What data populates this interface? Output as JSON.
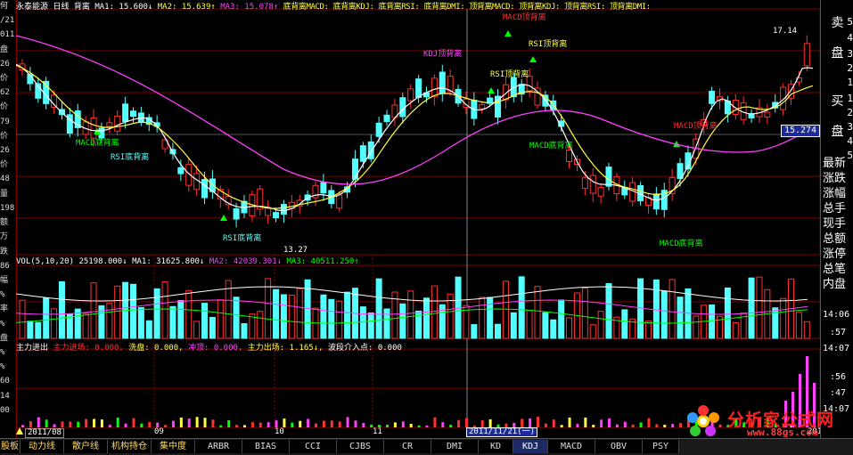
{
  "header": {
    "title": "永泰能源",
    "period": "日线",
    "indicator": "背离",
    "ma1": "MA1: 15.600↓",
    "ma2": "MA2: 15.639↑",
    "ma3": "MA3: 15.078↑",
    "signals": "底背离MACD: 底背离KDJ: 底背离RSI: 底背离DMI: 顶背离MACD: 顶背离KDJ: 顶背离RSI: 顶背离DMI:"
  },
  "volume_header": {
    "label": "VOL(5,10,20)",
    "value": "25198.000↓",
    "ma1": "MA1: 31625.800↓",
    "ma2": "MA2: 42039.301↓",
    "ma3": "MA3: 40511.250↑"
  },
  "money_header": {
    "label": "主力进出",
    "jinchang": "主力进场: 0.000,",
    "xipan": "洗盘: 0.000,",
    "chongding": "冲顶: 0.000,",
    "chuchang": "主力出场: 1.165↓,",
    "bodong": "波段介入点: 0.000"
  },
  "annotations": {
    "kdj_top": "KDJ顶背离",
    "macd_top": "MACD顶背离",
    "rsi_top1": "RSI顶背离",
    "rsi_top2": "RSI顶背离",
    "macd_bottom1": "MACD底背离",
    "rsi_bottom1": "RSI底背离",
    "rsi_bottom2": "RSI底背离",
    "macd_bottom2": "MACD底背离",
    "macd_bottom3": "MACD底背离",
    "macd_top2": "MACD顶背离",
    "low_price": "13.27",
    "high_price": "17.14",
    "current_price": "15.274"
  },
  "date_axis": {
    "labels": [
      "2011/08",
      "09",
      "10",
      "11",
      "2011/11/21(一)",
      "201"
    ]
  },
  "left_axis": {
    "labels": [
      "何",
      "/21",
      "011",
      "盘",
      "26",
      "价",
      "62",
      "价",
      "79",
      "价",
      "26",
      "价",
      "48",
      "量",
      "198",
      "额",
      "万",
      "跌",
      "86",
      "幅",
      "%",
      "率",
      "%",
      "盘",
      "%",
      "%",
      "60",
      "14",
      "00"
    ]
  },
  "right_panel": {
    "buy_top": "卖",
    "buy_bottom": "盘",
    "sell_top": "买",
    "sell_bottom": "盘",
    "levels": [
      "5",
      "4",
      "3",
      "2",
      "1",
      "1",
      "2",
      "3",
      "4",
      "5"
    ],
    "items": [
      "最新",
      "涨跌",
      "涨幅",
      "总手",
      "现手",
      "总额",
      "涨停",
      "总笔",
      "内盘"
    ],
    "times": [
      "14:06",
      ":57",
      "14:07",
      ":56",
      ":47",
      "14:07"
    ]
  },
  "tabs": [
    "股板",
    "动力线",
    "散户线",
    "机构持仓",
    "集中度",
    "ARBR",
    "BIAS",
    "CCI",
    "CJBS",
    "CR",
    "DMI",
    "KD",
    "KDJ",
    "MACD",
    "OBV",
    "PSY"
  ],
  "logo": {
    "text": "分析家公式网",
    "url": "www.88gs.com"
  },
  "colors": {
    "up": "#ff3030",
    "down": "#54ffff",
    "ma1": "#ffffff",
    "ma2": "#ffff40",
    "ma3": "#ff40ff",
    "grid": "#800000"
  }
}
